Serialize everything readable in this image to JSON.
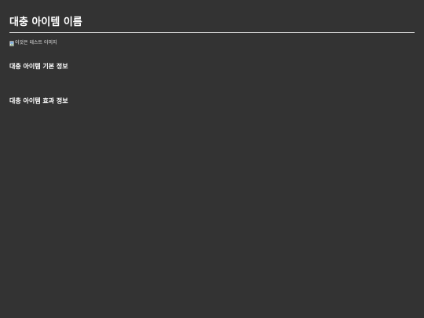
{
  "item": {
    "title": "대충 아이템 이름",
    "image_alt": "이것은 테스트 이미지"
  },
  "sections": {
    "basic_info": "대충 아이템 기본 정보",
    "effect_info": "대충 아이템 효과 정보"
  },
  "colors": {
    "background": "#333333",
    "text": "#ffffff",
    "divider": "#d9d9d9"
  }
}
